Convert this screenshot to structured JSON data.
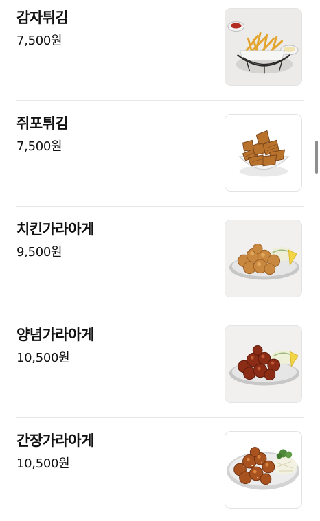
{
  "menu": {
    "items": [
      {
        "name": "감자튀김",
        "price": "7,500원",
        "photo": "french-fries-basket"
      },
      {
        "name": "쥐포튀김",
        "price": "7,500원",
        "photo": "fried-filefish-bowl"
      },
      {
        "name": "치킨가라아게",
        "price": "9,500원",
        "photo": "chicken-karaage-plate"
      },
      {
        "name": "양념가라아게",
        "price": "10,500원",
        "photo": "seasoned-karaage-plate"
      },
      {
        "name": "간장가라아게",
        "price": "10,500원",
        "photo": "soy-karaage-plate"
      }
    ]
  }
}
